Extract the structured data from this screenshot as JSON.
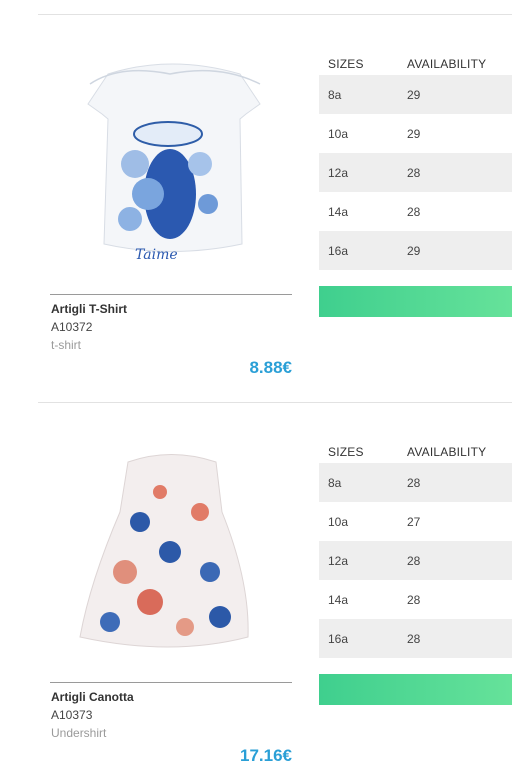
{
  "products": [
    {
      "name": "Artigli T-Shirt",
      "code": "A10372",
      "category": "t-shirt",
      "price": "8.88€",
      "image_icon": "tshirt-image",
      "table": {
        "col_sizes": "SIZES",
        "col_availability": "AVAILABILITY",
        "rows": [
          {
            "size": "8a",
            "qty": "29"
          },
          {
            "size": "10a",
            "qty": "29"
          },
          {
            "size": "12a",
            "qty": "28"
          },
          {
            "size": "14a",
            "qty": "28"
          },
          {
            "size": "16a",
            "qty": "29"
          }
        ]
      },
      "button_color": "#4fd98f"
    },
    {
      "name": "Artigli Canotta",
      "code": "A10373",
      "category": "Undershirt",
      "price": "17.16€",
      "image_icon": "floral-dress-image",
      "table": {
        "col_sizes": "SIZES",
        "col_availability": "AVAILABILITY",
        "rows": [
          {
            "size": "8a",
            "qty": "28"
          },
          {
            "size": "10a",
            "qty": "27"
          },
          {
            "size": "12a",
            "qty": "28"
          },
          {
            "size": "14a",
            "qty": "28"
          },
          {
            "size": "16a",
            "qty": "28"
          }
        ]
      },
      "button_color": "#4fd98f"
    }
  ],
  "colors": {
    "price": "#2a9fd6",
    "row_alt": "#eeeeee",
    "button": "#4fd98f"
  }
}
